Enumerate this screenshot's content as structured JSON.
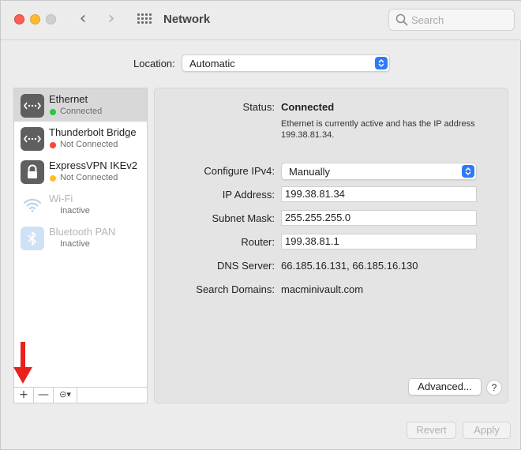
{
  "window": {
    "title": "Network",
    "search_placeholder": "Search",
    "nav_back": "‹",
    "nav_forward": "›"
  },
  "location": {
    "label": "Location:",
    "value": "Automatic"
  },
  "services": [
    {
      "name": "Ethernet",
      "status": "Connected",
      "status_color": "#28c840",
      "icon": "ethernet-icon",
      "selected": true,
      "active": true
    },
    {
      "name": "Thunderbolt Bridge",
      "status": "Not Connected",
      "status_color": "#ff453a",
      "icon": "thunderbolt-bridge-icon",
      "selected": false,
      "active": true
    },
    {
      "name": "ExpressVPN IKEv2",
      "status": "Not Connected",
      "status_color": "#febc2e",
      "icon": "lock-icon",
      "selected": false,
      "active": true
    },
    {
      "name": "Wi-Fi",
      "status": "Inactive",
      "icon": "wifi-icon",
      "selected": false,
      "active": false
    },
    {
      "name": "Bluetooth PAN",
      "status": "Inactive",
      "icon": "bluetooth-icon",
      "selected": false,
      "active": false
    }
  ],
  "sidebar_buttons": {
    "add": "+",
    "remove": "—",
    "action": "⊝▾"
  },
  "detail": {
    "status_label": "Status:",
    "status_value": "Connected",
    "status_description": "Ethernet is currently active and has the IP address 199.38.81.34.",
    "configure_label": "Configure IPv4:",
    "configure_value": "Manually",
    "ip_label": "IP Address:",
    "ip_value": "199.38.81.34",
    "subnet_label": "Subnet Mask:",
    "subnet_value": "255.255.255.0",
    "router_label": "Router:",
    "router_value": "199.38.81.1",
    "dns_label": "DNS Server:",
    "dns_value": "66.185.16.131, 66.185.16.130",
    "search_domains_label": "Search Domains:",
    "search_domains_value": "macminivault.com",
    "advanced_button": "Advanced...",
    "help_button": "?"
  },
  "footer": {
    "revert_button": "Revert",
    "apply_button": "Apply"
  },
  "colors": {
    "accent": "#2f7bf5",
    "annotation_arrow": "#e8211b"
  }
}
